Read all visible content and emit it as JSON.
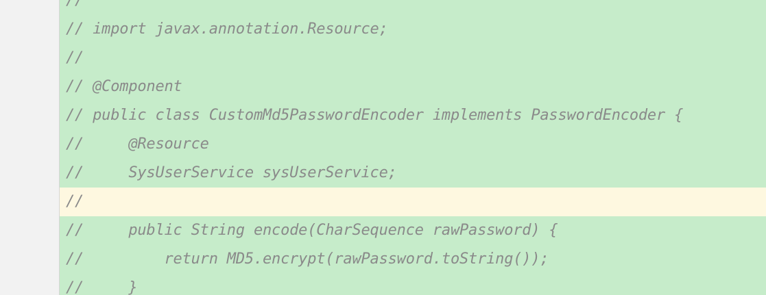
{
  "editor": {
    "lines": [
      {
        "text": "//",
        "current": false
      },
      {
        "text": "// import javax.annotation.Resource;",
        "current": false
      },
      {
        "text": "//",
        "current": false
      },
      {
        "text": "// @Component",
        "current": false
      },
      {
        "text": "// public class CustomMd5PasswordEncoder implements PasswordEncoder {",
        "current": false
      },
      {
        "text": "//     @Resource",
        "current": false
      },
      {
        "text": "//     SysUserService sysUserService;",
        "current": false
      },
      {
        "text": "//",
        "current": true
      },
      {
        "text": "//     public String encode(CharSequence rawPassword) {",
        "current": false
      },
      {
        "text": "//         return MD5.encrypt(rawPassword.toString());",
        "current": false
      },
      {
        "text": "//     }",
        "current": false
      }
    ],
    "colors": {
      "changed_background": "#c6ecca",
      "current_line_background": "#fef8e0",
      "gutter_background": "#f2f2f2",
      "comment_text": "#8a8a8a"
    }
  }
}
